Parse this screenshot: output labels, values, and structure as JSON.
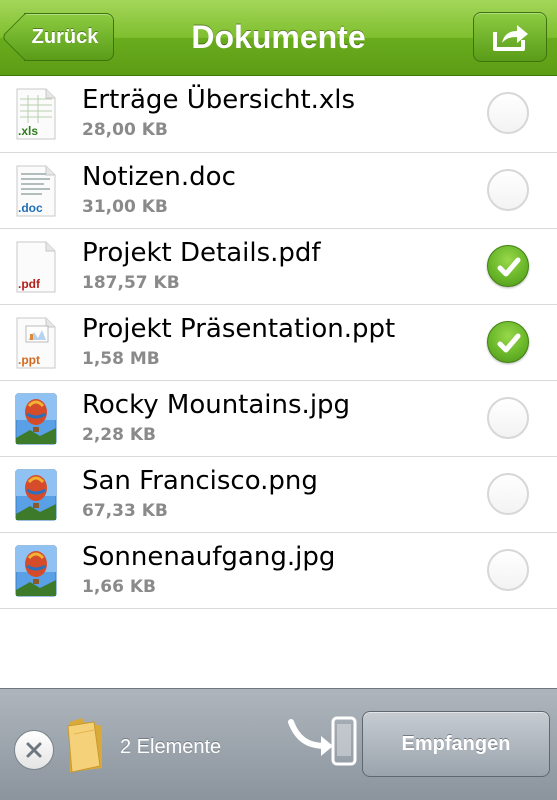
{
  "header": {
    "title": "Dokumente",
    "back_label": "Zurück",
    "share_icon": "share-icon"
  },
  "files": [
    {
      "name": "Erträge Übersicht.xls",
      "size": "28,00 KB",
      "type_label": ".xls",
      "icon": "spreadsheet-file-icon",
      "selected": false
    },
    {
      "name": "Notizen.doc",
      "size": "31,00 KB",
      "type_label": ".doc",
      "icon": "document-file-icon",
      "selected": false
    },
    {
      "name": "Projekt Details.pdf",
      "size": "187,57 KB",
      "type_label": ".pdf",
      "icon": "pdf-file-icon",
      "selected": true
    },
    {
      "name": "Projekt Präsentation.ppt",
      "size": "1,58 MB",
      "type_label": ".ppt",
      "icon": "presentation-file-icon",
      "selected": true
    },
    {
      "name": "Rocky Mountains.jpg",
      "size": "2,28 KB",
      "type_label": "",
      "icon": "image-file-icon",
      "selected": false
    },
    {
      "name": "San Francisco.png",
      "size": "67,33 KB",
      "type_label": "",
      "icon": "image-file-icon",
      "selected": false
    },
    {
      "name": "Sonnenaufgang.jpg",
      "size": "1,66 KB",
      "type_label": "",
      "icon": "image-file-icon",
      "selected": false
    }
  ],
  "bottombar": {
    "count_label": "2 Elemente",
    "receive_label": "Empfangen"
  },
  "colors": {
    "header_green": "#7fbf2e",
    "check_green": "#6ab72a",
    "size_gray": "#8a8a8a",
    "xls_green": "#2e7d1e",
    "doc_blue": "#1f6fb5",
    "pdf_red": "#b3201c",
    "ppt_orange": "#d2691e"
  }
}
